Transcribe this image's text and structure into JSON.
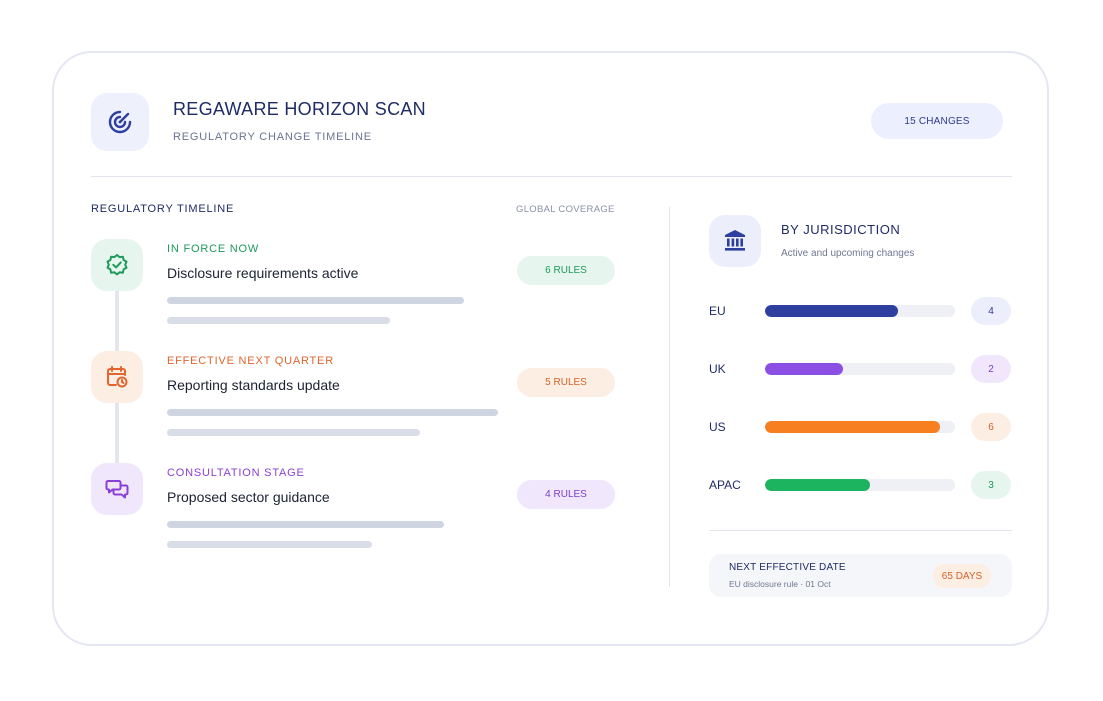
{
  "header": {
    "title": "REGAWARE HORIZON SCAN",
    "subtitle": "REGULATORY CHANGE TIMELINE",
    "changes_badge": "15 CHANGES",
    "icon": "radar-target-icon"
  },
  "timeline": {
    "label": "REGULATORY TIMELINE",
    "coverage_label": "GLOBAL COVERAGE",
    "items": [
      {
        "stage": "IN FORCE NOW",
        "title": "Disclosure requirements active",
        "rules": "6 RULES",
        "icon": "badge-check-icon",
        "color": "#1e9a5a",
        "bg": "#e6f6ee"
      },
      {
        "stage": "EFFECTIVE NEXT QUARTER",
        "title": "Reporting standards update",
        "rules": "5 RULES",
        "icon": "calendar-clock-icon",
        "color": "#e0652f",
        "bg": "#fdeee4"
      },
      {
        "stage": "CONSULTATION STAGE",
        "title": "Proposed sector guidance",
        "rules": "4 RULES",
        "icon": "chat-bubbles-icon",
        "color": "#8a3fd6",
        "bg": "#f1e7fc"
      }
    ]
  },
  "jurisdiction": {
    "title": "BY JURISDICTION",
    "subtitle": "Active and upcoming changes",
    "icon": "bank-building-icon",
    "rows": [
      {
        "label": "EU",
        "count": "4",
        "fill": 0.7,
        "color": "#2f3fa0",
        "pill_bg": "#eceffb",
        "pill_color": "#2f3c8f"
      },
      {
        "label": "UK",
        "count": "2",
        "fill": 0.41,
        "color": "#8b4fe3",
        "pill_bg": "#f1e7fc",
        "pill_color": "#7a3fc9"
      },
      {
        "label": "US",
        "count": "6",
        "fill": 0.92,
        "color": "#f77f20",
        "pill_bg": "#fdeee4",
        "pill_color": "#d1632a"
      },
      {
        "label": "APAC",
        "count": "3",
        "fill": 0.55,
        "color": "#1db45f",
        "pill_bg": "#e6f6ee",
        "pill_color": "#1e9a5a"
      }
    ]
  },
  "next_effective": {
    "title": "NEXT EFFECTIVE DATE",
    "detail": "EU disclosure rule · 01 Oct",
    "days": "65 DAYS"
  }
}
